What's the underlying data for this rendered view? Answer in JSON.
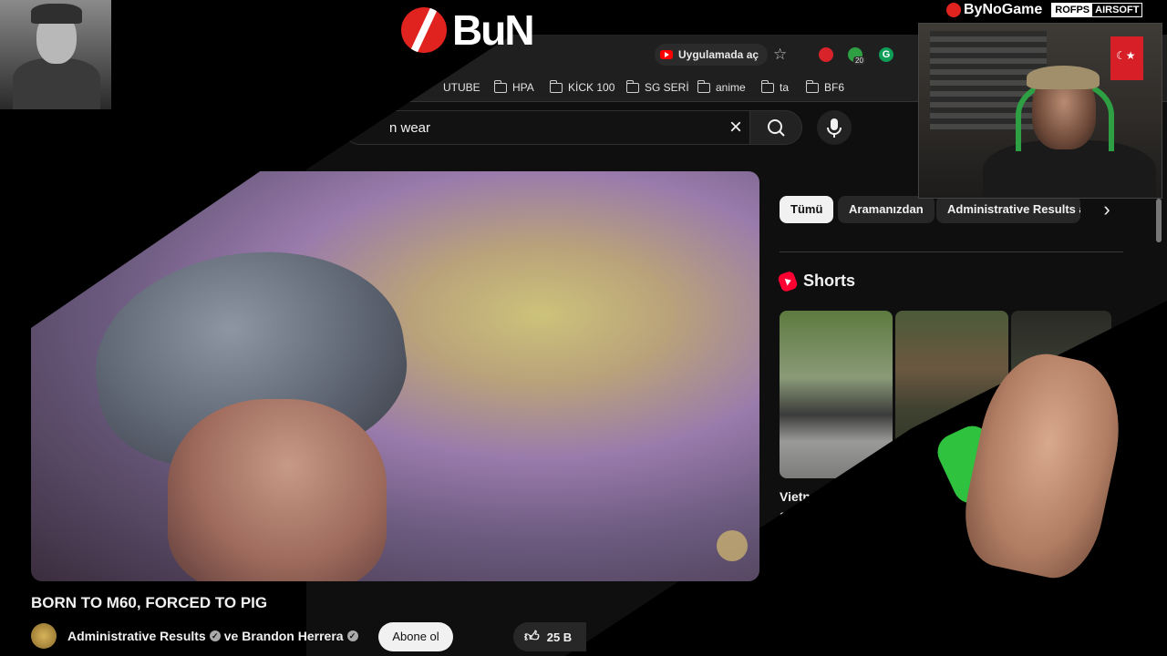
{
  "browser": {
    "open_in_app": "Uygulamada aç",
    "extension_badge": "20",
    "extension_g": "G",
    "bookmarks": [
      "UTUBE",
      "HPA",
      "KİCK 100",
      "SG SERİ",
      "anime",
      "ta",
      "BF6"
    ]
  },
  "search": {
    "value": "n wear",
    "clear_icon": "close-icon",
    "search_icon": "search-icon",
    "mic_icon": "mic-icon"
  },
  "chips": {
    "items": [
      "Tümü",
      "Aramanızdan",
      "Administrative Results a"
    ],
    "next_icon": "chevron-right-icon"
  },
  "shorts": {
    "heading": "Shorts",
    "first_caption": "Vietnam Vet fires a"
  },
  "video": {
    "title": "BORN TO M60, FORCED TO PIG",
    "owner_primary": "Administrative Results",
    "owner_joiner": "ve",
    "owner_secondary": "Brandon Herrera",
    "subscribe": "Abone ol",
    "likes": "25 B"
  },
  "overlay": {
    "bun_logo": "BuN",
    "bynogame": "ByNoGame",
    "rofps_left": "ROFPS",
    "rofps_right": "AIRSOFT"
  },
  "colors": {
    "page_bg": "#0f0f0f",
    "chip_active": "#f1f1f1",
    "youtube_red": "#ff0000",
    "brand_red": "#e0231e",
    "headset_green": "#2ea043"
  }
}
